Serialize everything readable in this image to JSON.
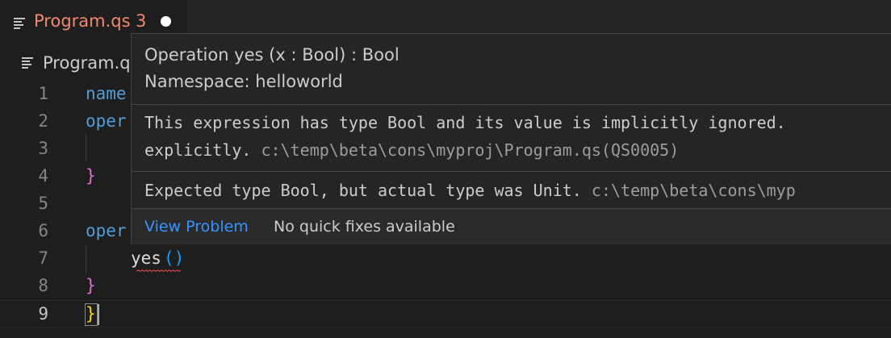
{
  "tab": {
    "label": "Program.qs",
    "problem_count": "3",
    "icon": "file-lines-icon"
  },
  "breadcrumb": {
    "label": "Program.qs"
  },
  "editor": {
    "line_numbers": [
      "1",
      "2",
      "3",
      "4",
      "5",
      "6",
      "7",
      "8",
      "9"
    ],
    "visible_code": {
      "line1": "name",
      "line2": "oper",
      "line4": "}",
      "line6": "oper",
      "line7_fn": "yes",
      "line7_parens": "()",
      "line8": "}",
      "line9": "}"
    }
  },
  "hover": {
    "signature": "Operation yes (x : Bool) : Bool",
    "namespace": "Namespace: helloworld",
    "diagnostics": [
      {
        "line1": "This expression has type Bool and its value is implicitly ignored.",
        "line2_text": "explicitly.",
        "line2_source": "c:\\temp\\beta\\cons\\myproj\\Program.qs(QS0005)"
      },
      {
        "line1_text": "Expected type Bool, but actual type was Unit.",
        "line1_source": "c:\\temp\\beta\\cons\\myp"
      }
    ],
    "actions": {
      "view_problem": "View Problem",
      "no_quick_fixes": "No quick fixes available"
    }
  },
  "colors": {
    "error_tab": "#f48771",
    "keyword": "#569cd6",
    "brace_purple": "#da70d6",
    "brace_yellow": "#ffd700",
    "link": "#3794ff",
    "squiggle": "#f14c4c"
  }
}
